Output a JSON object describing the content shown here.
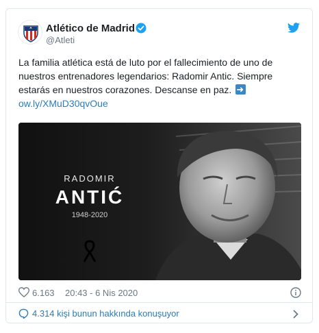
{
  "account": {
    "name": "Atlético de Madrid",
    "handle": "@Atleti"
  },
  "tweet": {
    "text": "La familia atlética está de luto por el fallecimiento de uno de nuestros entrenadores legendarios: Radomir Antic. Siempre estarás en nuestros corazones. Descanse en paz.",
    "link": "ow.ly/XMuD30qvOue"
  },
  "media": {
    "first_name": "RADOMIR",
    "last_name": "ANTIĆ",
    "years": "1948-2020"
  },
  "meta": {
    "likes": "6.163",
    "timestamp": "20:43 - 6 Nis 2020"
  },
  "conversation": {
    "label": "4.314 kişi bunun hakkında konuşuyor"
  },
  "colors": {
    "link": "#2b7bb9",
    "twitter_blue": "#1da1f2",
    "muted": "#697882"
  },
  "icons": [
    "atletico-crest-icon",
    "verified-badge-icon",
    "twitter-bird-icon",
    "arrow-emoji-icon",
    "heart-icon",
    "info-icon",
    "chat-bubble-icon",
    "chevron-right-icon",
    "mourning-ribbon-icon"
  ]
}
